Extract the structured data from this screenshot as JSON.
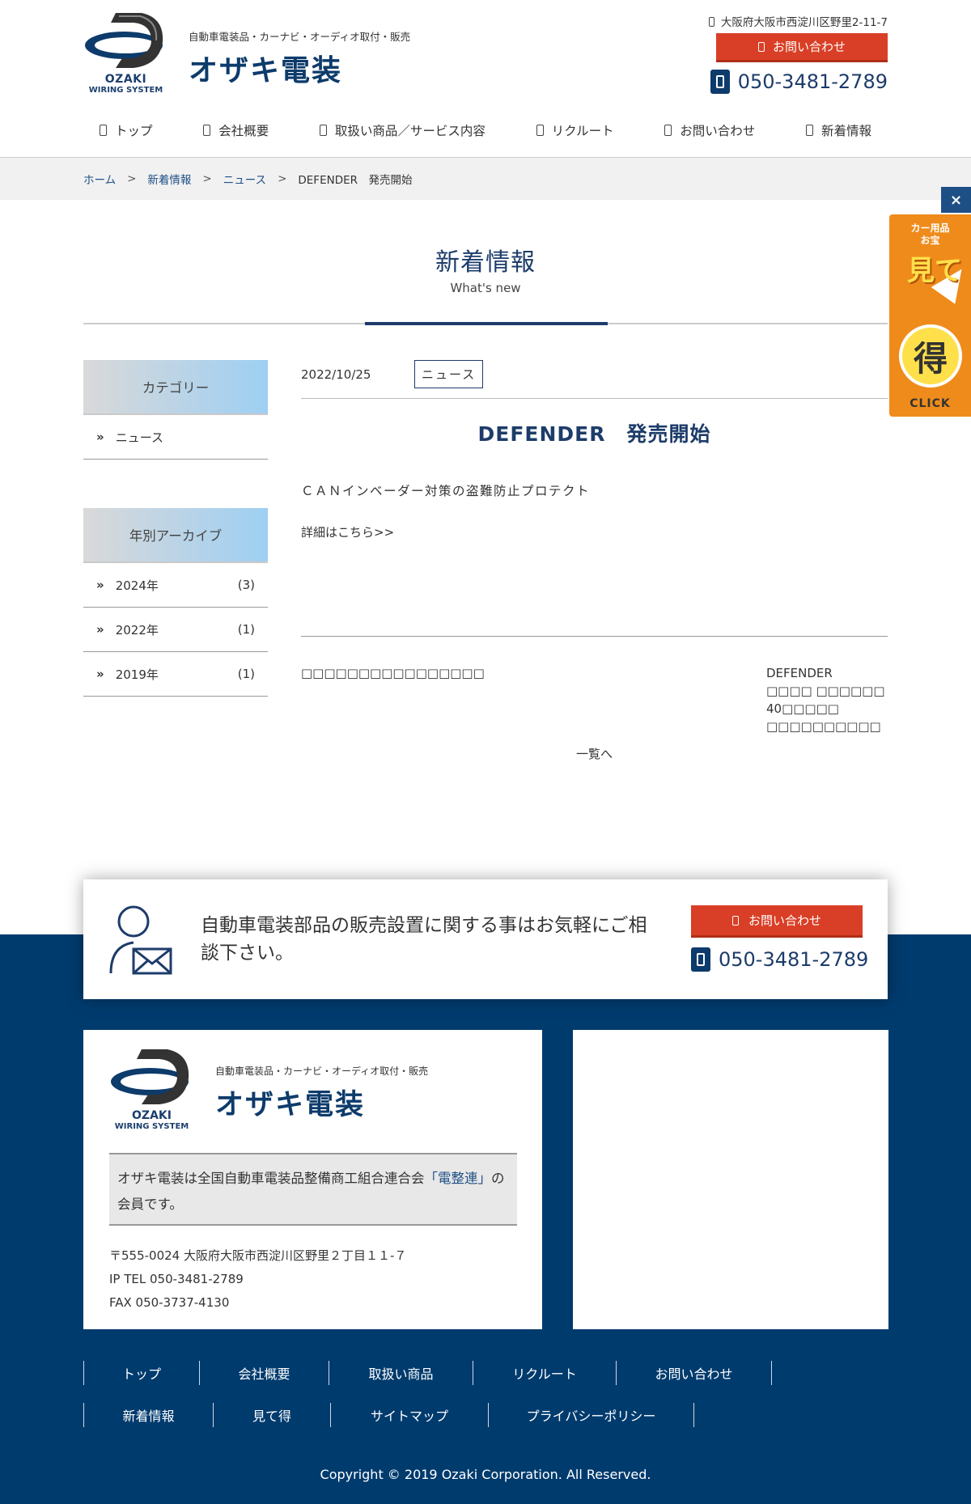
{
  "header": {
    "logo_text": "OZAKI",
    "logo_sub": "WIRING SYSTEM",
    "tagline": "自動車電装品・カーナビ・オーディオ取付・販売",
    "brand": "オザキ電装",
    "address": "大阪府大阪市西淀川区野里2-11-7",
    "contact_label": "お問い合わせ",
    "tel": "050-3481-2789"
  },
  "nav": [
    "トップ",
    "会社概要",
    "取扱い商品／サービス内容",
    "リクルート",
    "お問い合わせ",
    "新着情報"
  ],
  "breadcrumb": [
    "ホーム",
    "新着情報",
    "ニュース",
    "DEFENDER　発売開始"
  ],
  "breadcrumb_sep": ">",
  "side_banner": {
    "line1": "カー用品",
    "line2": "お宝",
    "big1": "見て",
    "big2": "得",
    "click": "CLICK",
    "close": "×"
  },
  "page_title": {
    "ja": "新着情報",
    "en": "What's new"
  },
  "sidebar": {
    "category_heading": "カテゴリー",
    "categories": [
      "ニュース"
    ],
    "archive_heading": "年別アーカイブ",
    "archives": [
      {
        "year": "2024年",
        "count": "(3)"
      },
      {
        "year": "2022年",
        "count": "(1)"
      },
      {
        "year": "2019年",
        "count": "(1)"
      }
    ],
    "chevron": "»"
  },
  "article": {
    "date": "2022/10/25",
    "tag": "ニュース",
    "title": "DEFENDER　発売開始",
    "body": "ＣＡＮインベーダー対策の盗難防止プロテクト",
    "link": "詳細はこちら>>",
    "prev": "□□□□□□□□□□□□□□□□",
    "next": "DEFENDER　□□□□ □□□□□□　40□□□□□ □□□□□□□□□□",
    "back": "一覧へ"
  },
  "cta": {
    "text": "自動車電装部品の販売設置に関する事はお気軽にご相談下さい。",
    "contact_label": "お問い合わせ",
    "tel": "050-3481-2789"
  },
  "footer": {
    "logo_text": "OZAKI",
    "logo_sub": "WIRING SYSTEM",
    "tagline": "自動車電装品・カーナビ・オーディオ取付・販売",
    "brand": "オザキ電装",
    "member_pre": "オザキ電装は全国自動車電装品整備商工組合連合会",
    "member_link": "「電整連」",
    "member_post": "の会員です。",
    "postal": "〒555-0024 大阪府大阪市西淀川区野里２丁目１１-７",
    "iptel": "IP TEL 050-3481-2789",
    "fax": "FAX 050-3737-4130",
    "nav_row1": [
      "トップ",
      "会社概要",
      "取扱い商品",
      "リクルート",
      "お問い合わせ"
    ],
    "nav_row2": [
      "新着情報",
      "見て得",
      "サイトマップ",
      "プライバシーポリシー"
    ],
    "copyright": "Copyright © 2019 Ozaki Corporation. All Reserved."
  },
  "colors": {
    "navy": "#003b6e",
    "accent_red": "#d93f26",
    "orange": "#ef8b1b",
    "link_blue": "#1d4f85"
  }
}
